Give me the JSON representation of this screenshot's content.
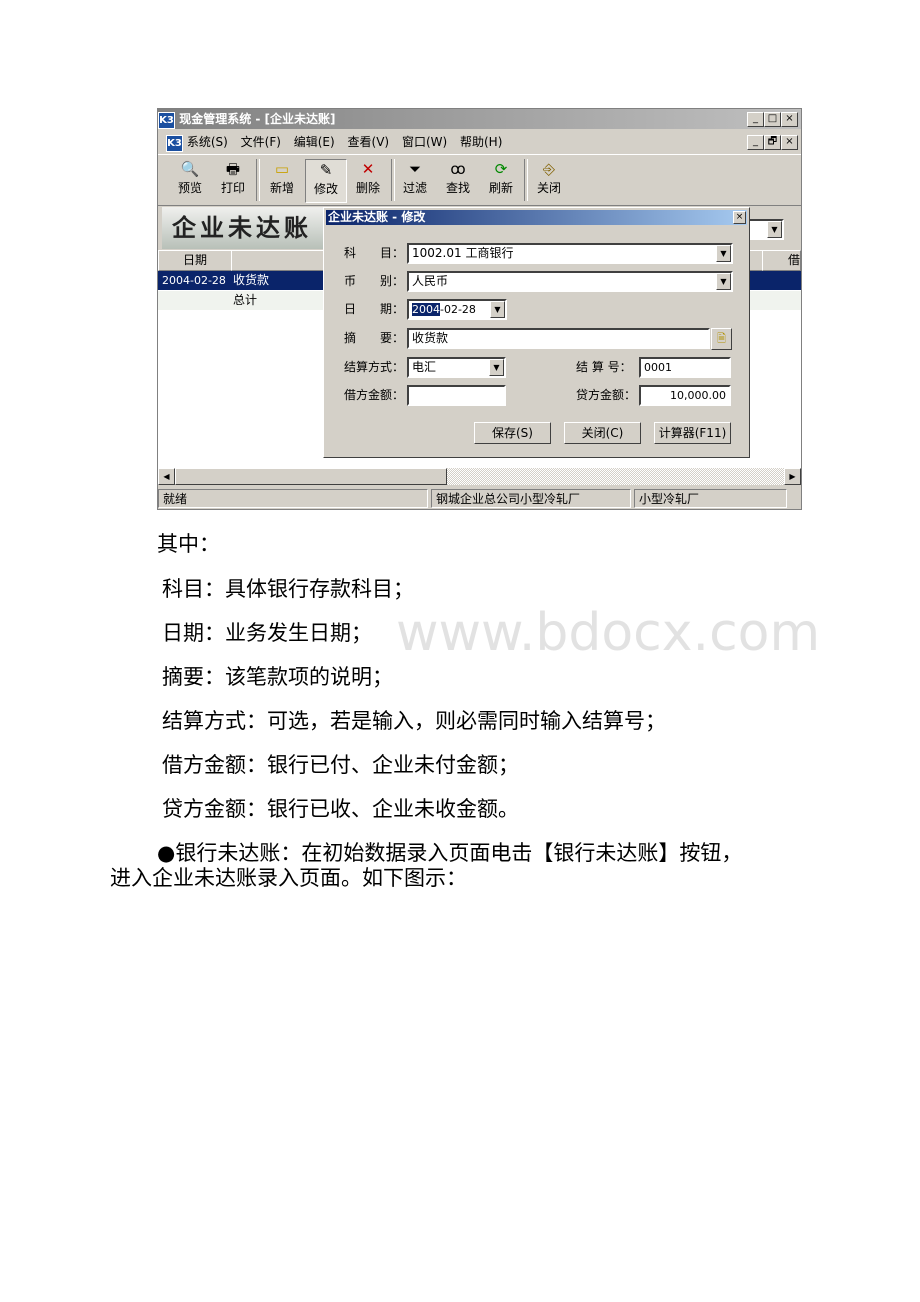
{
  "app": {
    "title": "现金管理系统 - [企业未达账]",
    "logo": "K3",
    "window_buttons": [
      "_",
      "□",
      "×"
    ],
    "mdi_buttons": [
      "_",
      "🗗",
      "×"
    ],
    "menu": [
      "系统(S)",
      "文件(F)",
      "编辑(E)",
      "查看(V)",
      "窗口(W)",
      "帮助(H)"
    ],
    "toolbar": [
      {
        "label": "预览",
        "icon": "preview-icon"
      },
      {
        "label": "打印",
        "icon": "printer-icon"
      },
      {
        "label": "新增",
        "icon": "new-icon"
      },
      {
        "label": "修改",
        "icon": "edit-icon",
        "active": true
      },
      {
        "label": "删除",
        "icon": "delete-icon"
      },
      {
        "label": "过滤",
        "icon": "filter-icon"
      },
      {
        "label": "查找",
        "icon": "binoculars-icon"
      },
      {
        "label": "刷新",
        "icon": "refresh-icon"
      },
      {
        "label": "关闭",
        "icon": "exit-icon"
      }
    ],
    "banner": "企业未达账",
    "grid": {
      "headers": [
        "日期",
        "",
        "借"
      ],
      "rows": [
        [
          "2004-02-28",
          "收货款"
        ],
        [
          "",
          "总计"
        ]
      ]
    },
    "status": [
      "就绪",
      "钢城企业总公司小型冷轧厂",
      "小型冷轧厂"
    ],
    "dialog": {
      "title": "企业未达账 - 修改",
      "subject_label": "科　　目：",
      "subject": "1002.01 工商银行",
      "currency_label": "币　　别：",
      "currency": "人民币",
      "date_label": "日　　期：",
      "date_sel": "2004",
      "date_rest": "-02-28",
      "summary_label": "摘　　要：",
      "summary": "收货款",
      "settle_label": "结算方式：",
      "settle": "电汇",
      "settle_no_label": "结 算 号：",
      "settle_no": "0001",
      "debit_label": "借方金额：",
      "debit": "",
      "credit_label": "贷方金额：",
      "credit": "10,000.00",
      "save": "保存(S)",
      "close": "关闭(C)",
      "calc": "计算器(F11)"
    }
  },
  "doc": {
    "lines": [
      "其中：",
      "科目：具体银行存款科目；",
      "日期：业务发生日期；",
      "摘要：该笔款项的说明；",
      "结算方式：可选，若是输入，则必需同时输入结算号；",
      "借方金额：银行已付、企业未付金额；",
      "贷方金额：银行已收、企业未收金额。",
      "●银行未达账：在初始数据录入页面电击【银行未达账】按钮，",
      "进入企业未达账录入页面。如下图示："
    ],
    "watermark": "www.bdocx.com"
  }
}
